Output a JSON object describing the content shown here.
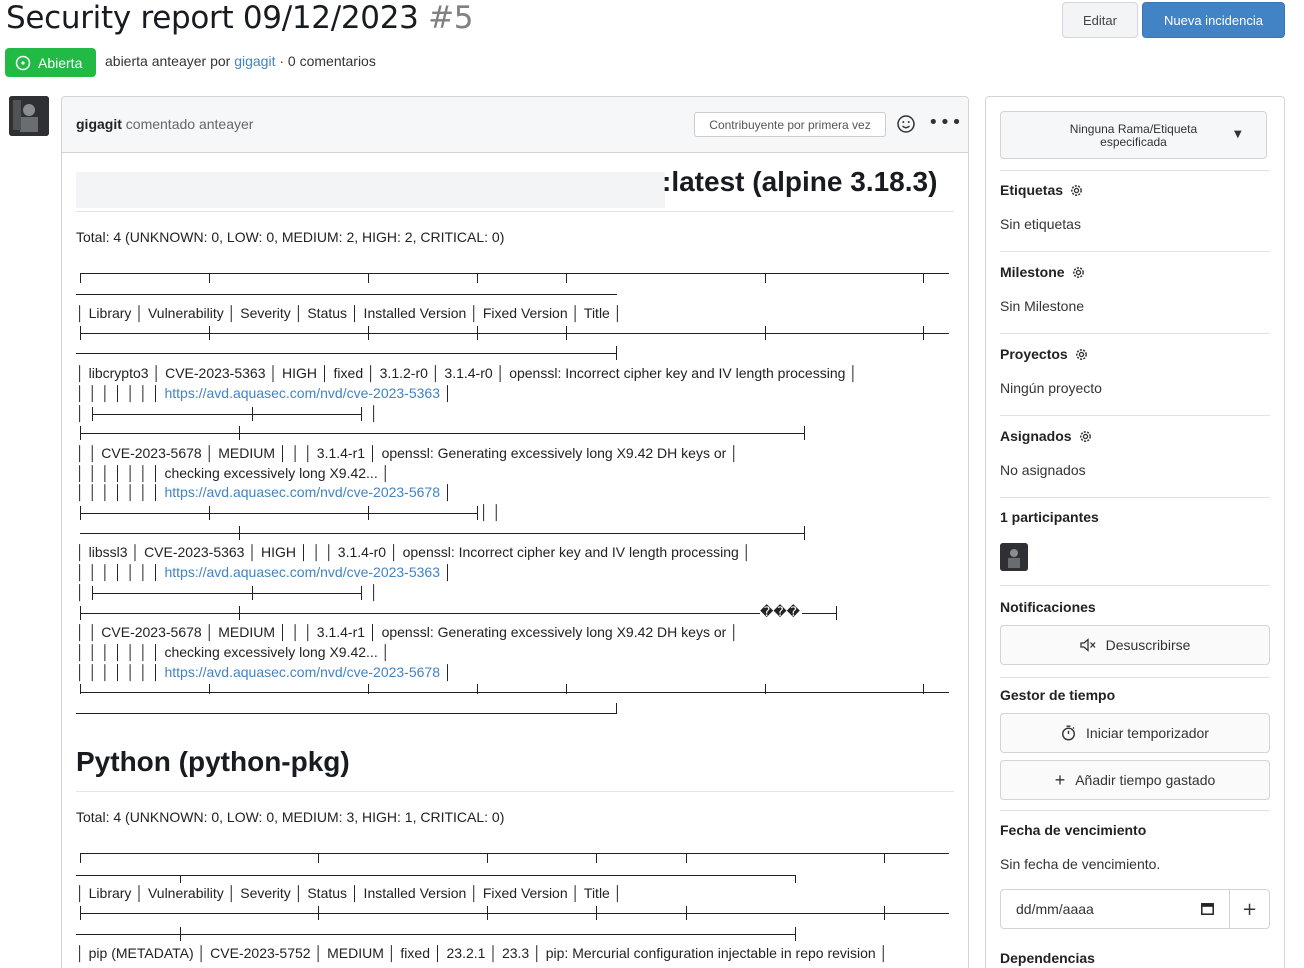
{
  "issue": {
    "title": "Security report 09/12/2023",
    "number": "#5",
    "status": "Abierta",
    "meta_prefix": "abierta anteayer por",
    "author": "gigagit",
    "meta_suffix": "· 0 comentarios"
  },
  "actions": {
    "edit": "Editar",
    "new_issue": "Nueva incidencia"
  },
  "comment": {
    "author": "gigagit",
    "action": "comentado anteayer",
    "contributor_badge": "Contribuyente por primera vez",
    "heading1": ":latest (alpine 3.18.3)",
    "total1": "Total: 4 (UNKNOWN: 0, LOW: 0, MEDIUM: 2, HIGH: 2, CRITICAL: 0)",
    "header_row": "│ Library │ Vulnerability │ Severity │ Status │ Installed Version │ Fixed Version │ Title │",
    "rows1": [
      "│ libcrypto3 │ CVE-2023-5363 │ HIGH │ fixed │ 3.1.2-r0 │ 3.1.4-r0 │ openssl: Incorrect cipher key and IV length processing │",
      "│ │ │ │ │ │ │",
      "│ ├",
      "│ │ CVE-2023-5678 │ MEDIUM │ │ │ 3.1.4-r1 │ openssl: Generating excessively long X9.42 DH keys or │",
      "│ │ │ │ │ │ │ checking excessively long X9.42... │",
      "│ │ │ │ │ │ │",
      "│ libssl3 │ CVE-2023-5363 │ HIGH │ │ │ 3.1.4-r0 │ openssl: Incorrect cipher key and IV length processing │",
      "│ │ │ │ │ │ │",
      "│ ├",
      "│ │ CVE-2023-5678 │ MEDIUM │ │ │ 3.1.4-r1 │ openssl: Generating excessively long X9.42 DH keys or │",
      "│ │ │ │ │ │ │ checking excessively long X9.42... │",
      "│ │ │ │ │ │ │"
    ],
    "links1": [
      "https://avd.aquasec.com/nvd/cve-2023-5363",
      "https://avd.aquasec.com/nvd/cve-2023-5678",
      "https://avd.aquasec.com/nvd/cve-2023-5363",
      "https://avd.aquasec.com/nvd/cve-2023-5678"
    ],
    "garbled": "���",
    "heading2": "Python (python-pkg)",
    "total2": "Total: 4 (UNKNOWN: 0, LOW: 0, MEDIUM: 3, HIGH: 1, CRITICAL: 0)",
    "row_pip": "│ pip (METADATA) │ CVE-2023-5752 │ MEDIUM │ fixed │ 23.2.1 │ 23.3 │ pip: Mercurial configuration injectable in repo revision │"
  },
  "sidebar": {
    "branch": "Ninguna Rama/Etiqueta especificada",
    "labels_title": "Etiquetas",
    "labels_value": "Sin etiquetas",
    "milestone_title": "Milestone",
    "milestone_value": "Sin Milestone",
    "projects_title": "Proyectos",
    "projects_value": "Ningún proyecto",
    "assignees_title": "Asignados",
    "assignees_value": "No asignados",
    "participants_title": "1 participantes",
    "notifications_title": "Notificaciones",
    "unsubscribe": "Desuscribirse",
    "time_title": "Gestor de tiempo",
    "start_timer": "Iniciar temporizador",
    "add_time": "Añadir tiempo gastado",
    "due_title": "Fecha de vencimiento",
    "due_value": "Sin fecha de vencimiento.",
    "date_placeholder": "dd/mm/aaaa",
    "dependencies_title": "Dependencias"
  },
  "colors": {
    "primary": "#4183c4",
    "open_green": "#21ba45"
  }
}
